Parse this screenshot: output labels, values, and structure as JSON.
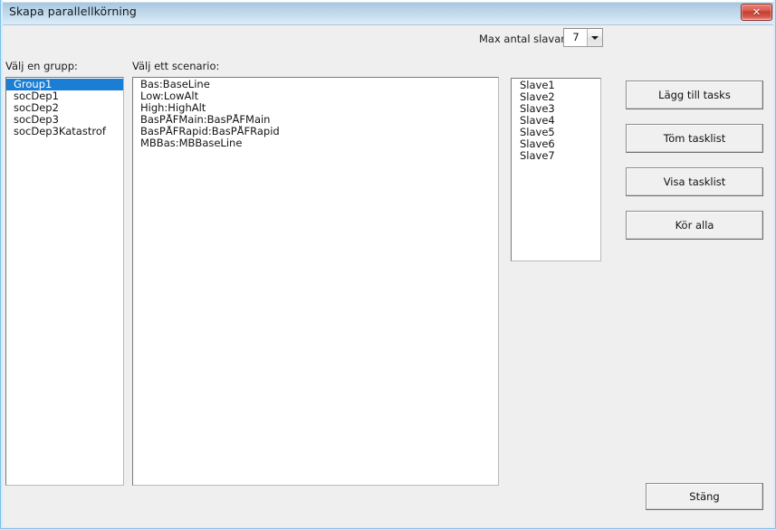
{
  "window": {
    "title": "Skapa parallellkörning",
    "close_icon": "close-x-icon",
    "close_glyph": "✕",
    "accent_color": "#1a7fd4",
    "titlebar_color": "#a4c3dc",
    "close_button_color": "#c43d30",
    "background_color": "#efefef"
  },
  "toolbar": {
    "slaves_label": "Max antal slavar:",
    "slaves_value": "7",
    "slaves_dropdown_icon": "chevron-down-icon"
  },
  "group_panel": {
    "label": "Välj en grupp:",
    "selected_index": 0,
    "items": [
      "Group1",
      "socDep1",
      "socDep2",
      "socDep3",
      "socDep3Katastrof"
    ]
  },
  "scenario_panel": {
    "label": "Välj ett scenario:",
    "items": [
      "Bas:BaseLine",
      "Low:LowAlt",
      "High:HighAlt",
      "BasPÅFMain:BasPÅFMain",
      "BasPÅFRapid:BasPÅFRapid",
      "MBBas:MBBaseLine"
    ]
  },
  "slave_panel": {
    "items": [
      "Slave1",
      "Slave2",
      "Slave3",
      "Slave4",
      "Slave5",
      "Slave6",
      "Slave7"
    ]
  },
  "actions": {
    "add_tasks": "Lägg till tasks",
    "clear_tasklist": "Töm tasklist",
    "show_tasklist": "Visa tasklist",
    "run_all": "Kör alla",
    "close": "Stäng"
  }
}
